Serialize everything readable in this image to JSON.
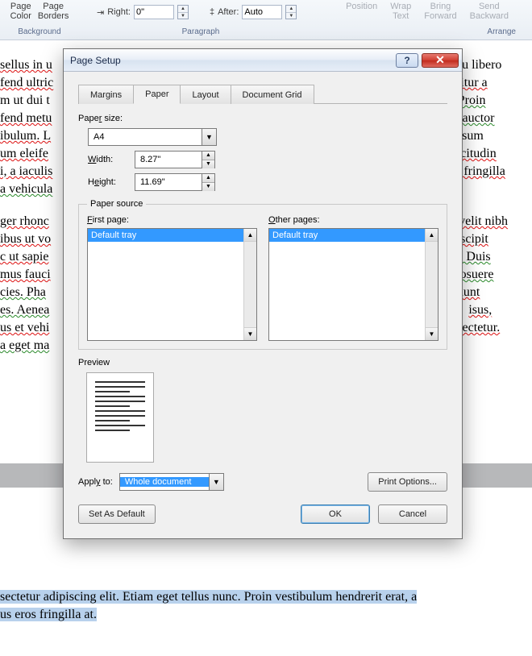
{
  "ribbon": {
    "page_color": "Page\nColor",
    "page_borders": "Page\nBorders",
    "background_group": "Background",
    "right_label": "Right:",
    "right_value": "0\"",
    "after_label": "After:",
    "after_value": "Auto",
    "paragraph_group": "Paragraph",
    "position": "Position",
    "wrap_text": "Wrap\nText",
    "bring_forward": "Bring\nForward",
    "send_backward": "Send\nBackward",
    "arrange_group": "Arrange"
  },
  "doc_lines": {
    "l1a": "sellus in u",
    "l1b": "e eu libero",
    "l2a": "fend ultric",
    "l2b": "abitur a",
    "l3a": "m ut dui t",
    "l3b": "o. Proin",
    "l4a": "fend metu",
    "l4b": "da auctor",
    "l5a": "ibulum. L",
    "l5b": "sum",
    "l6a": "um eleife",
    "l6b": "ollicitudin",
    "l7a": "i, a iaculis",
    "l7b": "on fringilla",
    "l8a": "a vehicula",
    "l8b": "",
    "l9a": "ger rhonc",
    "l9b": "us velit nibh",
    "l10a": "ibus ut vo",
    "l10b": "uscipit",
    "l11a": "c ut sapie",
    "l11b": ". Duis",
    "l12a": "mus fauci",
    "l12b": "posuere",
    "l13a": "cies. Pha",
    "l13b": "dunt",
    "l14a": "es. Aenea",
    "l14b": "isus,",
    "l15a": "us et vehi",
    "l15b": "onsectetur.",
    "l16a": "a eget ma",
    "l16b": ""
  },
  "doc_bottom": {
    "line1": "sectetur adipiscing elit. Etiam eget tellus nunc. Proin vestibulum hendrerit erat, a",
    "line2": "us eros fringilla at."
  },
  "dialog": {
    "title": "Page Setup",
    "tabs": {
      "margins": "Margins",
      "paper": "Paper",
      "layout": "Layout",
      "grid": "Document Grid"
    },
    "paper_size_label": "Paper size:",
    "paper_size_value": "A4",
    "width_label": "Width:",
    "width_value": "8.27\"",
    "height_label": "Height:",
    "height_value": "11.69\"",
    "paper_source_legend": "Paper source",
    "first_page_label": "First page:",
    "other_pages_label": "Other pages:",
    "default_tray": "Default tray",
    "preview_label": "Preview",
    "apply_to_label": "Apply to:",
    "apply_to_value": "Whole document",
    "print_options": "Print Options...",
    "set_default": "Set As Default",
    "ok": "OK",
    "cancel": "Cancel"
  }
}
